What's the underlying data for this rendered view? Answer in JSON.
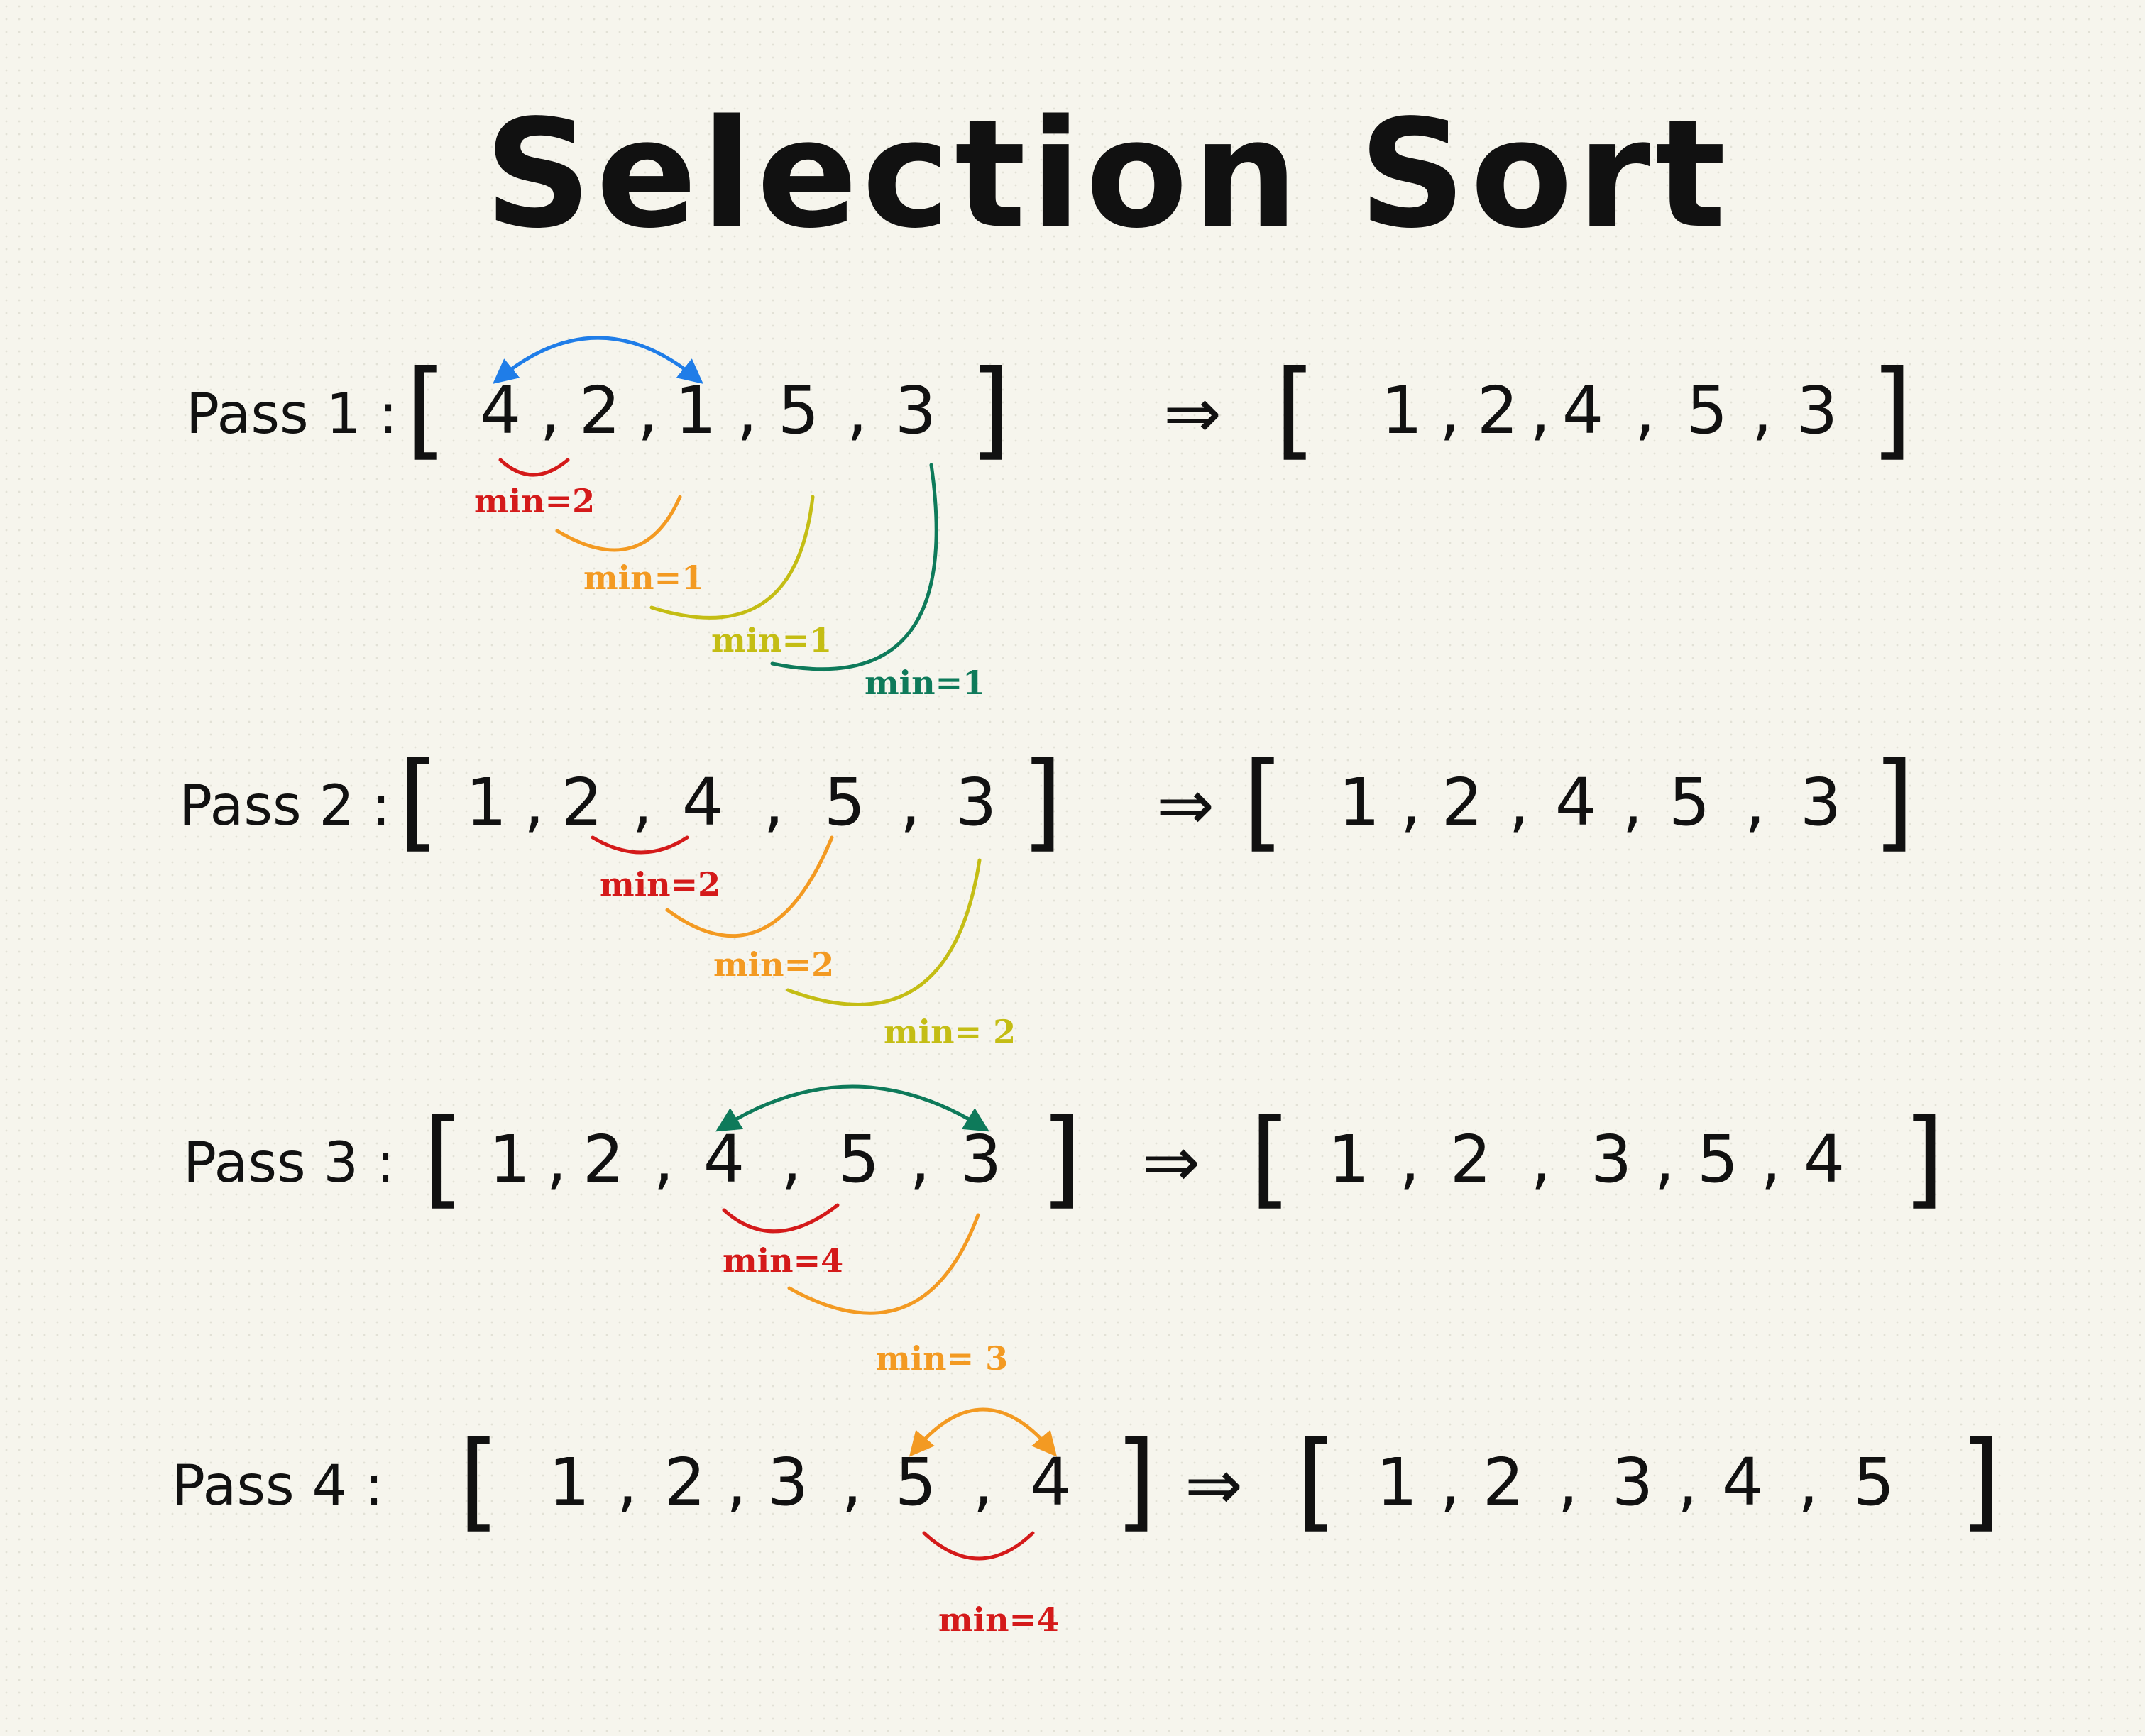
{
  "title": "Selection Sort",
  "colors": {
    "ink": "#111111",
    "red": "#d41a1a",
    "orange": "#f39a22",
    "yellow_green": "#c4bd14",
    "green": "#0e7a5a",
    "blue": "#1f7de8"
  },
  "passes": [
    {
      "label": "Pass 1 :",
      "arrow": "⇒",
      "input": [
        "4",
        "2",
        "1",
        "5",
        "3"
      ],
      "output": [
        "1",
        "2",
        "4",
        "5",
        "3"
      ],
      "output_highlight_color": "#1f7de8",
      "swap_color": "#1f7de8",
      "comparisons": [
        "min=2",
        "min=1",
        "min=1",
        "min=1"
      ]
    },
    {
      "label": "Pass 2 :",
      "arrow": "⇒",
      "input": [
        "1",
        "2",
        "4",
        "5",
        "3"
      ],
      "output": [
        "1",
        "2",
        "4",
        "5",
        "3"
      ],
      "comparisons": [
        "min=2",
        "min=2",
        "min= 2"
      ]
    },
    {
      "label": "Pass 3 :",
      "arrow": "⇒",
      "input": [
        "1",
        "2",
        "4",
        "5",
        "3"
      ],
      "output": [
        "1",
        "2",
        "3",
        "5",
        "4"
      ],
      "output_highlight_color": "#0e7a5a",
      "swap_color": "#0e7a5a",
      "comparisons": [
        "min=4",
        "min= 3"
      ]
    },
    {
      "label": "Pass 4 :",
      "arrow": "⇒",
      "input": [
        "1",
        "2",
        "3",
        "5",
        "4"
      ],
      "output": [
        "1",
        "2",
        "3",
        "4",
        "5"
      ],
      "output_highlight_color": "#f39a22",
      "swap_color": "#f39a22",
      "comparisons": [
        "min=4"
      ]
    }
  ]
}
